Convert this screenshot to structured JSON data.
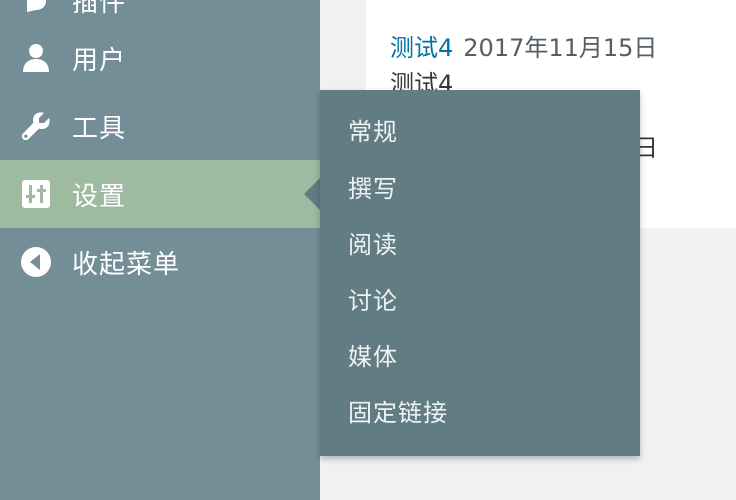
{
  "sidebar": {
    "items": [
      {
        "id": "plugins",
        "label": "插件",
        "icon": "plugin-icon"
      },
      {
        "id": "users",
        "label": "用户",
        "icon": "user-icon"
      },
      {
        "id": "tools",
        "label": "工具",
        "icon": "wrench-icon"
      },
      {
        "id": "settings",
        "label": "设置",
        "icon": "settings-sliders-icon",
        "active": true
      },
      {
        "id": "collapse",
        "label": "收起菜单",
        "icon": "collapse-arrow-icon"
      }
    ]
  },
  "submenu": {
    "items": [
      {
        "label": "常规"
      },
      {
        "label": "撰写"
      },
      {
        "label": "阅读"
      },
      {
        "label": "讨论"
      },
      {
        "label": "媒体"
      },
      {
        "label": "固定链接"
      }
    ]
  },
  "content": {
    "post1": {
      "title": "测试4",
      "date": "2017年11月15日",
      "excerpt": "测试4"
    },
    "post2": {
      "date_fragment": "日"
    }
  },
  "colors": {
    "sidebar_bg": "#738e96",
    "active_bg": "#9ebaa0",
    "flyout_bg": "#627c83",
    "link": "#0073aa"
  }
}
